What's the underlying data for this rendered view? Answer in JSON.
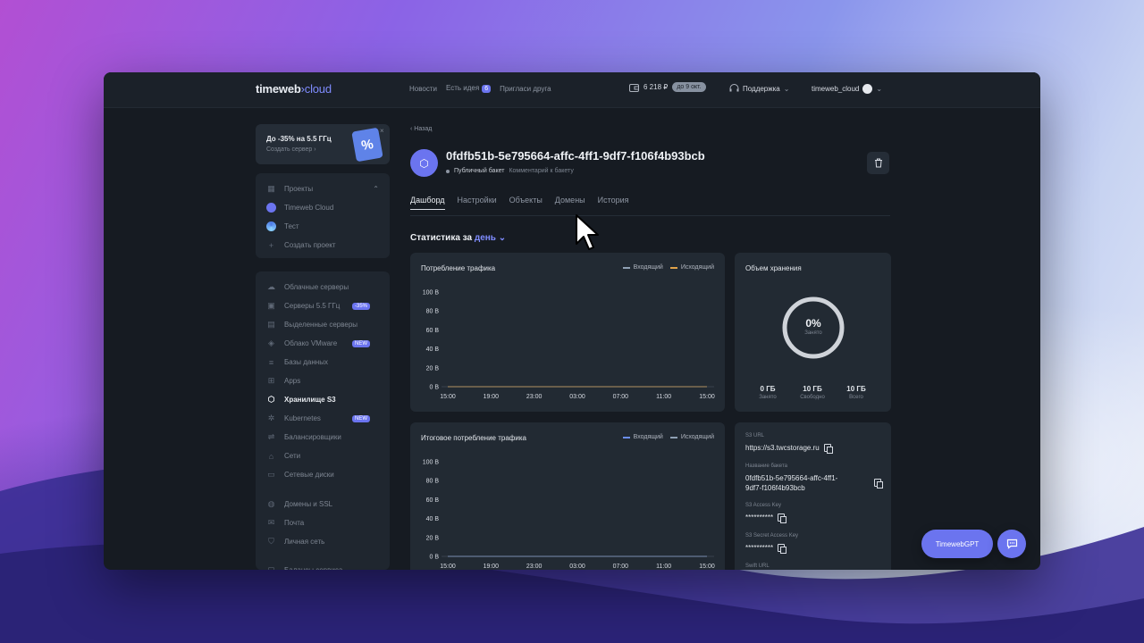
{
  "topbar": {
    "logo_main": "timeweb",
    "logo_accent": "cloud",
    "nav": [
      "Новости",
      "Есть идея",
      "Пригласи друга"
    ],
    "ideas_count": "6",
    "balance": "6 218 ₽",
    "balance_until": "до 9 окт.",
    "support": "Поддержка",
    "username": "timeweb_cloud"
  },
  "promo": {
    "title": "До -35% на 5.5 ГГц",
    "link": "Создать сервер",
    "tag": "%",
    "close": "×"
  },
  "projects": {
    "header": "Проекты",
    "items": [
      "Timeweb Cloud",
      "Тест"
    ],
    "create": "Создать проект"
  },
  "menu": {
    "items": [
      {
        "label": "Облачные серверы",
        "icon": "cloud-icon"
      },
      {
        "label": "Серверы 5.5 ГГц",
        "icon": "server-icon",
        "badge": "-35%"
      },
      {
        "label": "Выделенные серверы",
        "icon": "dedicated-icon"
      },
      {
        "label": "Облако VMware",
        "icon": "vmware-icon",
        "badge": "NEW"
      },
      {
        "label": "Базы данных",
        "icon": "database-icon"
      },
      {
        "label": "Apps",
        "icon": "apps-icon"
      },
      {
        "label": "Хранилище S3",
        "icon": "cube-icon",
        "active": true
      },
      {
        "label": "Kubernetes",
        "icon": "kubernetes-icon",
        "badge": "NEW"
      },
      {
        "label": "Балансировщики",
        "icon": "balancer-icon"
      },
      {
        "label": "Сети",
        "icon": "network-icon"
      },
      {
        "label": "Сетевые диски",
        "icon": "disk-icon"
      },
      {
        "label": "Домены и SSL",
        "icon": "globe-icon"
      },
      {
        "label": "Почта",
        "icon": "mail-icon"
      },
      {
        "label": "Личная сеть",
        "icon": "shield-icon"
      },
      {
        "label": "Балансы сервиса",
        "icon": "wallet-icon"
      }
    ]
  },
  "bucket": {
    "back": "Назад",
    "name": "0fdfb51b-5e795664-affc-4ff1-9df7-f106f4b93bcb",
    "type": "Публичный бакет",
    "comment": "Комментарий к бакету"
  },
  "tabs": [
    "Дашборд",
    "Настройки",
    "Объекты",
    "Домены",
    "История"
  ],
  "stats": {
    "label": "Статистика за",
    "period": "день"
  },
  "traffic": {
    "title": "Потребление трафика",
    "legend_in": "Входящий",
    "legend_out": "Исходящий",
    "color_in": "#8fa0b4",
    "color_out": "#e0a24a"
  },
  "total_traffic": {
    "title": "Итоговое потребление трафика",
    "legend_in": "Входящий",
    "legend_out": "Исходящий",
    "color_in": "#6b8ef0",
    "color_out": "#8fa0b4"
  },
  "chart_data": [
    {
      "type": "line",
      "title": "Потребление трафика",
      "x": [
        "15:00",
        "19:00",
        "23:00",
        "03:00",
        "07:00",
        "11:00",
        "15:00"
      ],
      "yticks": [
        "100 B",
        "80 B",
        "60 B",
        "40 B",
        "20 B",
        "0 B"
      ],
      "ylim": [
        0,
        100
      ],
      "series": [
        {
          "name": "Входящий",
          "values": [
            0,
            0,
            0,
            0,
            0,
            0,
            0
          ]
        },
        {
          "name": "Исходящий",
          "values": [
            0,
            0,
            0,
            0,
            0,
            0,
            0
          ]
        }
      ]
    },
    {
      "type": "line",
      "title": "Итоговое потребление трафика",
      "x": [
        "15:00",
        "19:00",
        "23:00",
        "03:00",
        "07:00",
        "11:00",
        "15:00"
      ],
      "yticks": [
        "100 B",
        "80 B",
        "60 B",
        "40 B",
        "20 B",
        "0 B"
      ],
      "ylim": [
        0,
        100
      ],
      "series": [
        {
          "name": "Входящий",
          "values": [
            0,
            0,
            0,
            0,
            0,
            0,
            0
          ]
        },
        {
          "name": "Исходящий",
          "values": [
            0,
            0,
            0,
            0,
            0,
            0,
            0
          ]
        }
      ]
    }
  ],
  "storage": {
    "title": "Объем хранения",
    "percent": "0%",
    "percent_label": "Занято",
    "used_fraction": 0.0,
    "used": "0 ГБ",
    "used_label": "Занято",
    "free": "10 ГБ",
    "free_label": "Свободно",
    "total": "10 ГБ",
    "total_label": "Всего"
  },
  "info": {
    "s3_url_label": "S3 URL",
    "s3_url": "https://s3.twcstorage.ru",
    "bucket_name_label": "Название бакета",
    "bucket_name_line1": "0fdfb51b-5e795664-affc-4ff1-",
    "bucket_name_line2": "9df7-f106f4b93bcb",
    "access_key_label": "S3 Access Key",
    "access_key": "**********",
    "secret_key_label": "S3 Secret Access Key",
    "secret_key": "**********",
    "swift_label": "Swift URL"
  },
  "floating": {
    "gpt": "TimewebGPT"
  }
}
